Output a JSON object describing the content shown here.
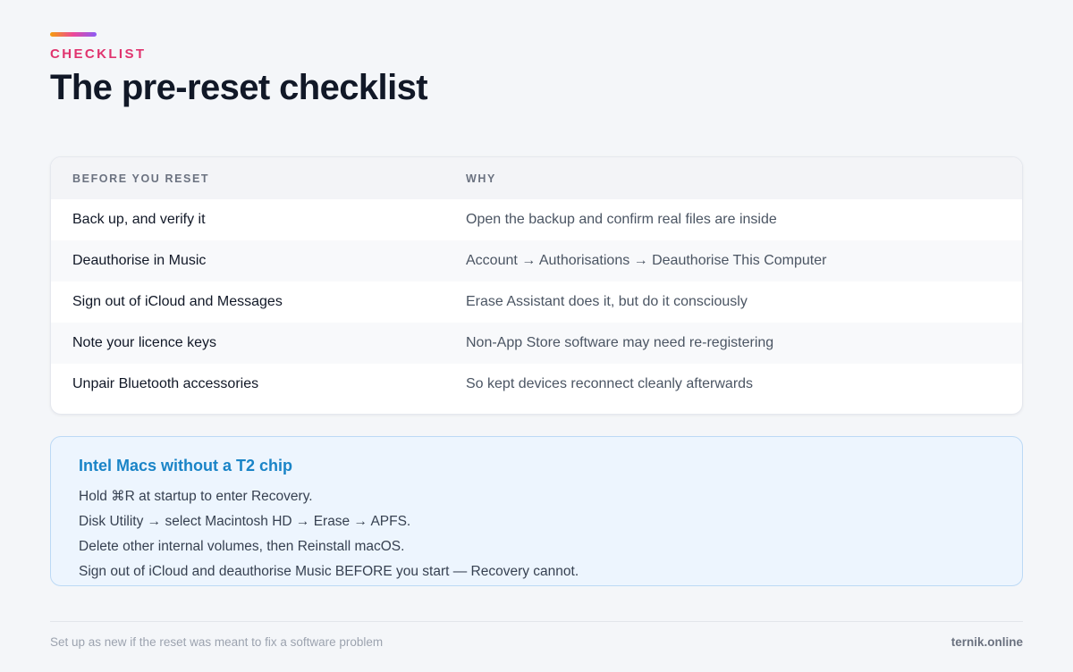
{
  "header": {
    "eyebrow": "CHECKLIST",
    "title": "The pre-reset checklist"
  },
  "table": {
    "columns": [
      "BEFORE YOU RESET",
      "WHY"
    ],
    "rows": [
      {
        "item": "Back up, and verify it",
        "why": "Open the backup and confirm real files are inside"
      },
      {
        "item": "Deauthorise in Music",
        "why": "Account → Authorisations → Deauthorise This Computer"
      },
      {
        "item": "Sign out of iCloud and Messages",
        "why": "Erase Assistant does it, but do it consciously"
      },
      {
        "item": "Note your licence keys",
        "why": "Non-App Store software may need re-registering"
      },
      {
        "item": "Unpair Bluetooth accessories",
        "why": "So kept devices reconnect cleanly afterwards"
      }
    ]
  },
  "note": {
    "title": "Intel Macs without a T2 chip",
    "lines": [
      "Hold ⌘R at startup to enter Recovery.",
      "Disk Utility → select Macintosh HD → Erase → APFS.",
      "Delete other internal volumes, then Reinstall macOS.",
      "Sign out of iCloud and deauthorise Music BEFORE you start — Recovery cannot."
    ]
  },
  "footer": {
    "left": "Set up as new if the reset was meant to fix a software problem",
    "right": "ternik.online"
  },
  "colors": {
    "eyebrow": "#e0336e",
    "note_title": "#1a84c7",
    "note_bg": "#edf5fe"
  }
}
